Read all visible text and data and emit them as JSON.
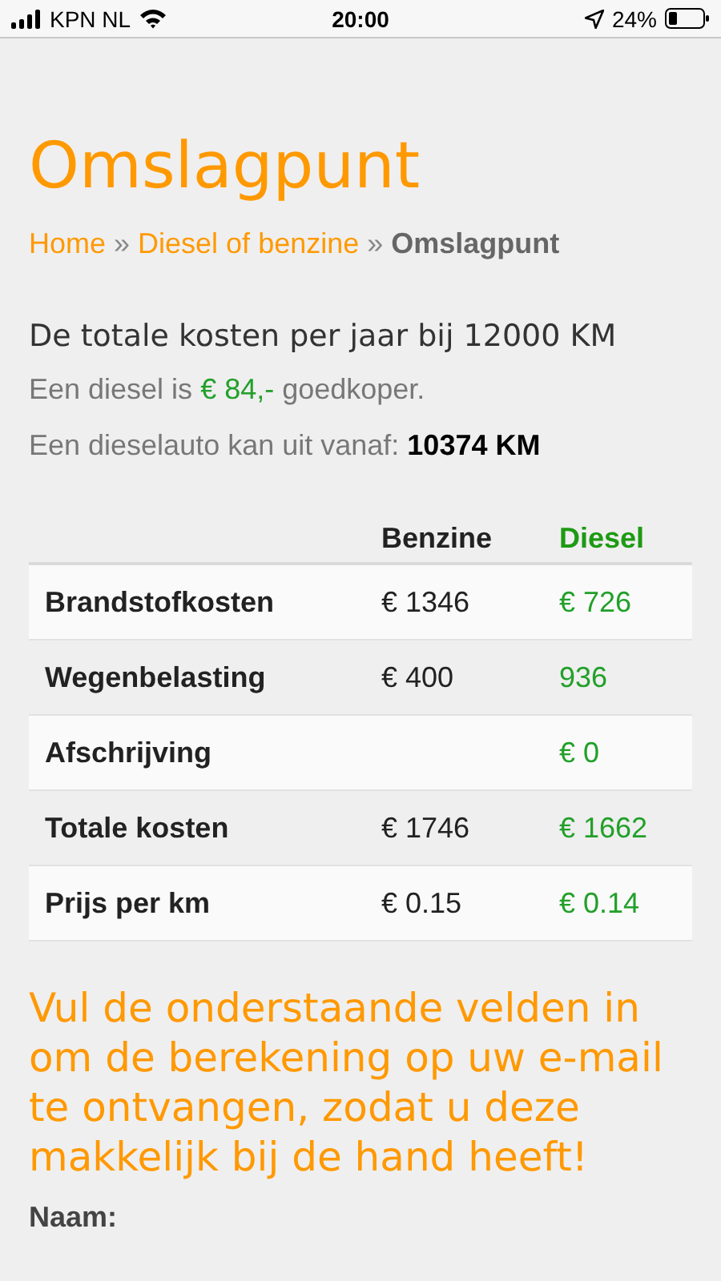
{
  "status_bar": {
    "carrier": "KPN NL",
    "time": "20:00",
    "battery": "24%"
  },
  "title": "Omslagpunt",
  "breadcrumb": [
    {
      "kind": "link",
      "label": "Home"
    },
    {
      "kind": "separator",
      "label": "»"
    },
    {
      "kind": "link",
      "label": "Diesel of benzine"
    },
    {
      "kind": "separator",
      "label": "»"
    },
    {
      "kind": "current",
      "label": "Omslagpunt"
    }
  ],
  "summary": {
    "heading": "De totale kosten per jaar bij 12000 KM",
    "saving_prefix": "Een diesel is ",
    "saving_amount": "€ 84,-",
    "saving_suffix": " goedkoper.",
    "break_even": "Een dieselauto kan uit vanaf: **10374 KM**"
  },
  "table": {
    "columns": [
      "Benzine",
      "Diesel"
    ],
    "rows": [
      {
        "label": "Brandstofkosten",
        "benzine": "€ 1346",
        "diesel": "€ 726"
      },
      {
        "label": "Wegenbelasting",
        "benzine": "€ 400",
        "diesel": "936"
      },
      {
        "label": "Afschrijving",
        "diesel": "€ 0"
      },
      {
        "label": "Totale kosten",
        "benzine": "€ 1746",
        "diesel": "€ 1662"
      },
      {
        "label": "Prijs per km",
        "benzine": "€ 0.15",
        "diesel": "€ 0.14"
      }
    ]
  },
  "form": {
    "intro": "Vul de onderstaande velden in om de berekening op uw e-mail te ontvangen, zodat u deze makkelijk bij de hand heeft!",
    "name_label": "Naam:"
  }
}
